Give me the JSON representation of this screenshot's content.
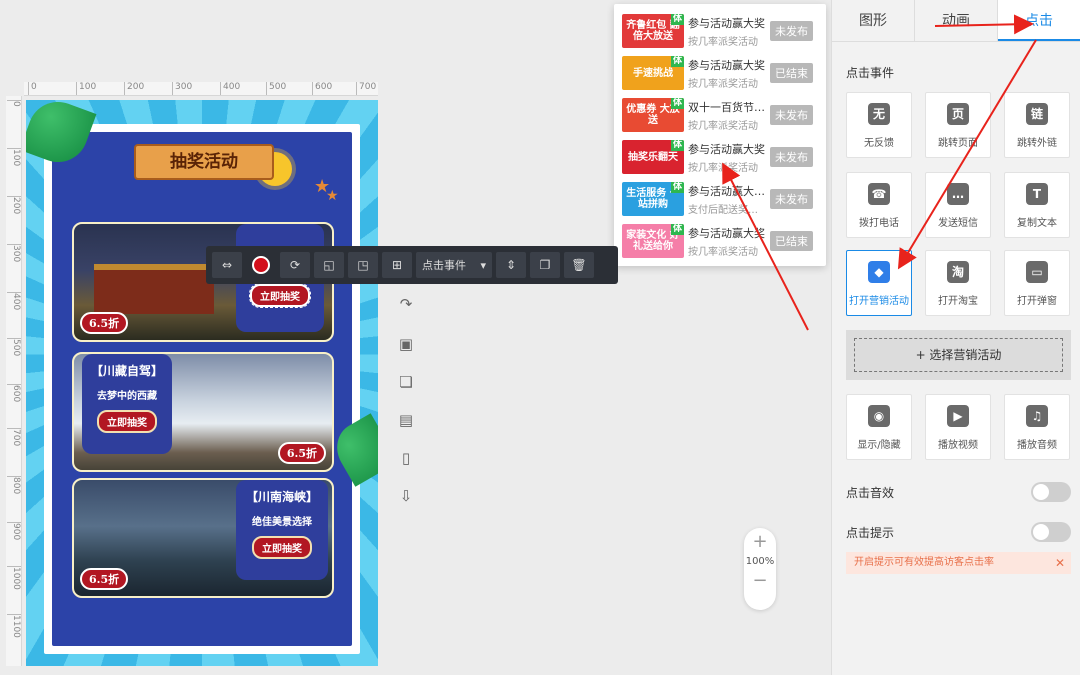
{
  "ruler": {
    "top": [
      "0",
      "100",
      "200",
      "300",
      "400",
      "500",
      "600",
      "700"
    ],
    "left": [
      "0",
      "100",
      "200",
      "300",
      "400",
      "500",
      "600",
      "700",
      "800",
      "900",
      "1000",
      "1100"
    ]
  },
  "canvas": {
    "title": "抽奖活动",
    "cards": [
      {
        "badge": "6.5折",
        "promo_button": "立即抽奖"
      },
      {
        "badge": "6.5折",
        "promo_title": "【川藏自驾】",
        "promo_sub": "去梦中的西藏",
        "promo_button": "立即抽奖"
      },
      {
        "badge": "6.5折",
        "promo_title": "【川南海峡】",
        "promo_sub": "绝佳美景选择",
        "promo_button": "立即抽奖"
      }
    ]
  },
  "toolbar": {
    "event_select": "点击事件"
  },
  "zoom": {
    "level": "100%"
  },
  "activity_list": [
    {
      "thumb": "齐鲁红包 翻倍大放送",
      "color": "#e23a3a",
      "tag": "体",
      "title": "参与活动赢大奖",
      "sub": "按几率派奖活动",
      "status": "未发布"
    },
    {
      "thumb": "手速挑战",
      "color": "#f0a21c",
      "tag": "体",
      "title": "参与活动赢大奖",
      "sub": "按几率派奖活动",
      "status": "已结束"
    },
    {
      "thumb": "优惠券 大放送",
      "color": "#e84b33",
      "tag": "体",
      "title": "双十一百货节…",
      "sub": "按几率派奖活动",
      "status": "未发布"
    },
    {
      "thumb": "抽奖乐翻天",
      "color": "#d9232f",
      "tag": "体",
      "title": "参与活动赢大奖",
      "sub": "按几率派奖活动",
      "status": "未发布"
    },
    {
      "thumb": "生活服务 一站拼购",
      "color": "#2aa0e0",
      "tag": "体",
      "title": "参与活动赢大…",
      "sub": "支付后配送奖…",
      "status": "未发布"
    },
    {
      "thumb": "家装文化 好礼送给你",
      "color": "#f57ea8",
      "tag": "体",
      "title": "参与活动赢大奖",
      "sub": "按几率派奖活动",
      "status": "已结束"
    }
  ],
  "panel": {
    "tabs": [
      "图形",
      "动画",
      "点击"
    ],
    "section_title": "点击事件",
    "events_row1": [
      {
        "icon": "无",
        "label": "无反馈"
      },
      {
        "icon": "页",
        "label": "跳转页面"
      },
      {
        "icon": "链",
        "label": "跳转外链"
      }
    ],
    "events_row2": [
      {
        "icon": "☎",
        "label": "拨打电话"
      },
      {
        "icon": "…",
        "label": "发送短信"
      },
      {
        "icon": "T",
        "label": "复制文本"
      }
    ],
    "events_row3": [
      {
        "icon": "◆",
        "label": "打开营销活动"
      },
      {
        "icon": "淘",
        "label": "打开淘宝"
      },
      {
        "icon": "▭",
        "label": "打开弹窗"
      }
    ],
    "select_activity": "+ 选择营销活动",
    "events_row4": [
      {
        "icon": "◉",
        "label": "显示/隐藏"
      },
      {
        "icon": "▶",
        "label": "播放视频"
      },
      {
        "icon": "♫",
        "label": "播放音频"
      }
    ],
    "click_sound": "点击音效",
    "click_hint": "点击提示",
    "tip": "开启提示可有效提高访客点击率",
    "tip_close": "✕"
  },
  "colors": {
    "accent": "#1a8ae6",
    "arrow": "#e8231c"
  }
}
